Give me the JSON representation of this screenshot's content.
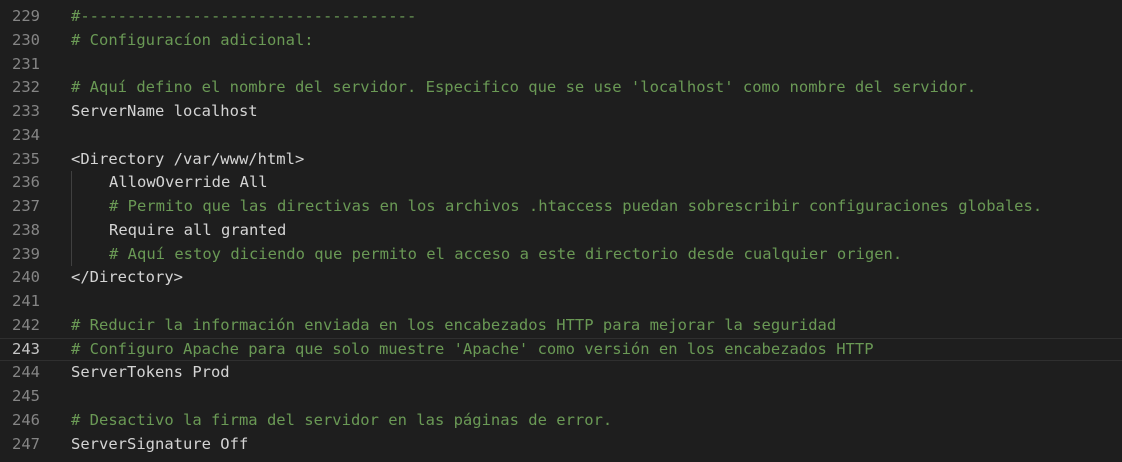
{
  "editor": {
    "lines": [
      {
        "number": "229",
        "text": "#------------------------------------",
        "kind": "comment",
        "indent": false
      },
      {
        "number": "230",
        "text": "# Configuracíon adicional:",
        "kind": "comment",
        "indent": false
      },
      {
        "number": "231",
        "text": "",
        "kind": "plain",
        "indent": false
      },
      {
        "number": "232",
        "text": "# Aquí defino el nombre del servidor. Especifico que se use 'localhost' como nombre del servidor.",
        "kind": "comment",
        "indent": false
      },
      {
        "number": "233",
        "text": "ServerName localhost",
        "kind": "plain",
        "indent": false
      },
      {
        "number": "234",
        "text": "",
        "kind": "plain",
        "indent": false
      },
      {
        "number": "235",
        "text": "<Directory /var/www/html>",
        "kind": "plain",
        "indent": false
      },
      {
        "number": "236",
        "text": "AllowOverride All",
        "kind": "plain",
        "indent": true
      },
      {
        "number": "237",
        "text": "# Permito que las directivas en los archivos .htaccess puedan sobrescribir configuraciones globales.",
        "kind": "comment",
        "indent": true
      },
      {
        "number": "238",
        "text": "Require all granted",
        "kind": "plain",
        "indent": true
      },
      {
        "number": "239",
        "text": "# Aquí estoy diciendo que permito el acceso a este directorio desde cualquier origen.",
        "kind": "comment",
        "indent": true
      },
      {
        "number": "240",
        "text": "</Directory>",
        "kind": "plain",
        "indent": false
      },
      {
        "number": "241",
        "text": "",
        "kind": "plain",
        "indent": false
      },
      {
        "number": "242",
        "text": "# Reducir la información enviada en los encabezados HTTP para mejorar la seguridad",
        "kind": "comment",
        "indent": false
      },
      {
        "number": "243",
        "text": "# Configuro Apache para que solo muestre 'Apache' como versión en los encabezados HTTP",
        "kind": "comment",
        "indent": false,
        "current": true
      },
      {
        "number": "244",
        "text": "ServerTokens Prod",
        "kind": "plain",
        "indent": false
      },
      {
        "number": "245",
        "text": "",
        "kind": "plain",
        "indent": false
      },
      {
        "number": "246",
        "text": "# Desactivo la firma del servidor en las páginas de error.",
        "kind": "comment",
        "indent": false
      },
      {
        "number": "247",
        "text": "ServerSignature Off",
        "kind": "plain",
        "indent": false
      }
    ]
  },
  "colors": {
    "background": "#1e1e1e",
    "comment": "#6a9955",
    "text": "#d4d4d4",
    "line_number": "#858585",
    "current_line_number": "#c6c6c6"
  }
}
